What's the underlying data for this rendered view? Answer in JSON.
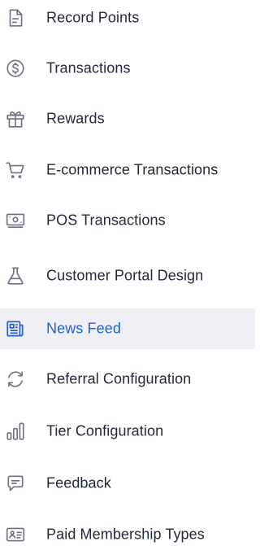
{
  "sidebar": {
    "active_color": "#2563c9",
    "active_background": "#eef0f6",
    "items": [
      {
        "label": "Record Points",
        "icon": "document-icon",
        "active": false
      },
      {
        "label": "Transactions",
        "icon": "dollar-circle-icon",
        "active": false
      },
      {
        "label": "Rewards",
        "icon": "gift-icon",
        "active": false
      },
      {
        "label": "E-commerce Transactions",
        "icon": "cart-icon",
        "active": false
      },
      {
        "label": "POS Transactions",
        "icon": "cash-icon",
        "active": false
      },
      {
        "label": "Customer Portal Design",
        "icon": "flask-icon",
        "active": false
      },
      {
        "label": "News Feed",
        "icon": "newspaper-icon",
        "active": true
      },
      {
        "label": "Referral Configuration",
        "icon": "refresh-icon",
        "active": false
      },
      {
        "label": "Tier Configuration",
        "icon": "bar-chart-icon",
        "active": false
      },
      {
        "label": "Feedback",
        "icon": "chat-icon",
        "active": false
      },
      {
        "label": "Paid Membership Types",
        "icon": "id-card-icon",
        "active": false
      }
    ]
  }
}
